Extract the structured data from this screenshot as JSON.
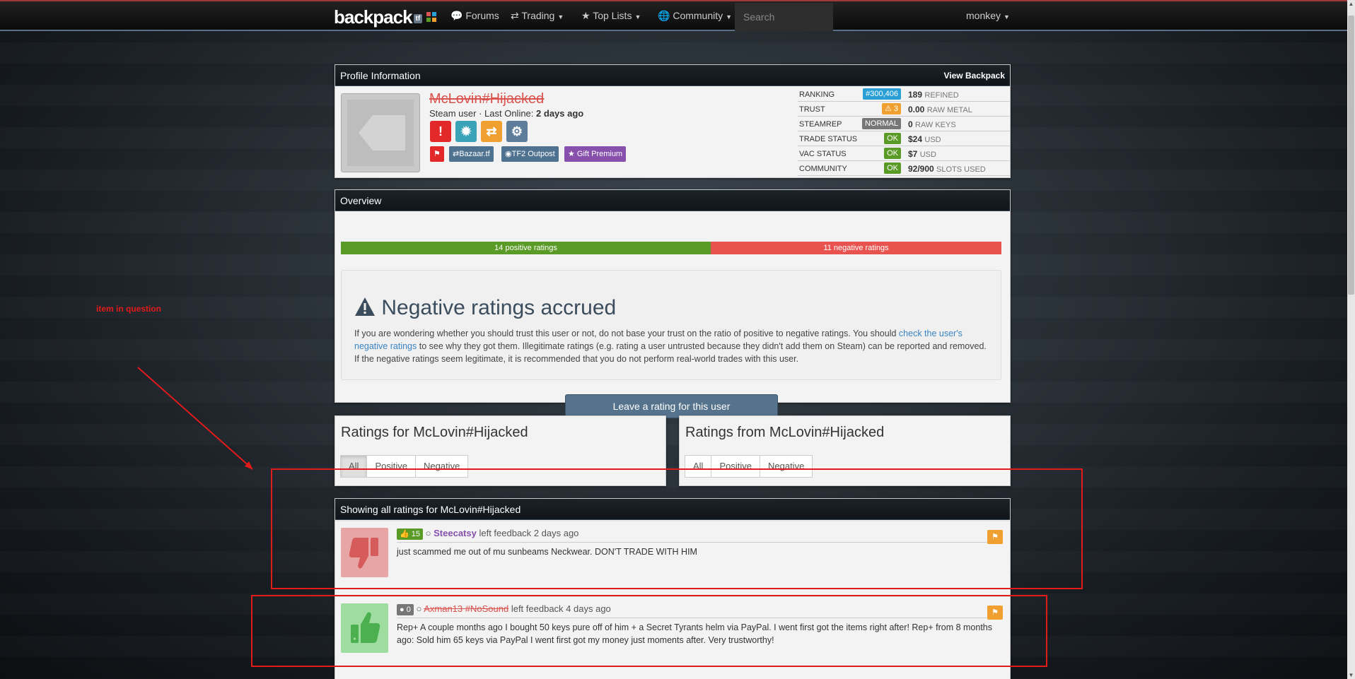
{
  "navbar": {
    "brand": "backpack",
    "brand_tf": "tf",
    "items": [
      {
        "label": "Forums"
      },
      {
        "label": "Trading"
      },
      {
        "label": "Top Lists"
      },
      {
        "label": "Community"
      }
    ],
    "search_placeholder": "Search",
    "user": "monkey"
  },
  "profile": {
    "heading": "Profile Information",
    "view_backpack": "View Backpack",
    "username": "McLovin#Hijacked",
    "steam_user": "Steam user · Last Online:",
    "last_online": "2 days ago",
    "tags": [
      "Bazaar.tf",
      "TF2 Outpost",
      "Gift Premium"
    ],
    "stats": [
      {
        "label": "Ranking",
        "badge": "#300,406",
        "badge_color": "#2a9fd6",
        "value": "189",
        "unit": "REFINED"
      },
      {
        "label": "Trust",
        "badge": "⚠ 3",
        "badge_color": "#f0a030",
        "value": "0.00",
        "unit": "RAW METAL"
      },
      {
        "label": "Steamrep",
        "badge": "NORMAL",
        "badge_color": "#777777",
        "value": "0",
        "unit": "RAW KEYS"
      },
      {
        "label": "Trade Status",
        "badge": "OK",
        "badge_color": "#5a9a26",
        "value": "$24",
        "unit": "USD"
      },
      {
        "label": "VAC Status",
        "badge": "OK",
        "badge_color": "#5a9a26",
        "value": "$7",
        "unit": "USD"
      },
      {
        "label": "Community",
        "badge": "OK",
        "badge_color": "#5a9a26",
        "value": "92/900",
        "unit": "SLOTS USED"
      }
    ]
  },
  "overview": {
    "heading": "Overview",
    "positive_label": "14 positive ratings",
    "negative_label": "11 negative ratings",
    "positive_count": 14,
    "negative_count": 11,
    "warn_title": "Negative ratings accrued",
    "warn_text_1": "If you are wondering whether you should trust this user or not, do not base your trust on the ratio of positive to negative ratings. You should ",
    "warn_link": "check the user's negative ratings",
    "warn_text_2": " to see why they got them. Illegitimate ratings (e.g. rating a user untrusted because they didn't add them on Steam) can be reported and removed. If the negative ratings seem legitimate, it is recommended that you do not perform real-world trades with this user.",
    "leave_button": "Leave a rating for this user"
  },
  "ratings_for": {
    "title": "Ratings for McLovin#Hijacked",
    "filters": [
      "All",
      "Positive",
      "Negative"
    ]
  },
  "ratings_from": {
    "title": "Ratings from McLovin#Hijacked",
    "filters": [
      "All",
      "Positive",
      "Negative"
    ]
  },
  "feed": {
    "heading": "Showing all ratings for McLovin#Hijacked",
    "items": [
      {
        "count": "15",
        "count_color": "#5a9a26",
        "user": "Steecatsy",
        "action": "left feedback",
        "time": "2 days ago",
        "text": "just scammed me out of mu sunbeams Neckwear. DON'T TRADE WITH HIM"
      },
      {
        "count": "0",
        "count_color": "#777777",
        "user": "Axman13 #NoSound",
        "action": "left feedback",
        "time": "4 days ago",
        "text": "Rep+ A couple months ago I bought 50 keys pure off of him + a Secret Tyrants helm via PayPal. I went first got the items right after! Rep+ from 8 months ago: Sold him 65 keys via PayPal I went first got my money just moments after. Very trustworthy!"
      }
    ]
  },
  "annotation": {
    "text": "item in question"
  }
}
